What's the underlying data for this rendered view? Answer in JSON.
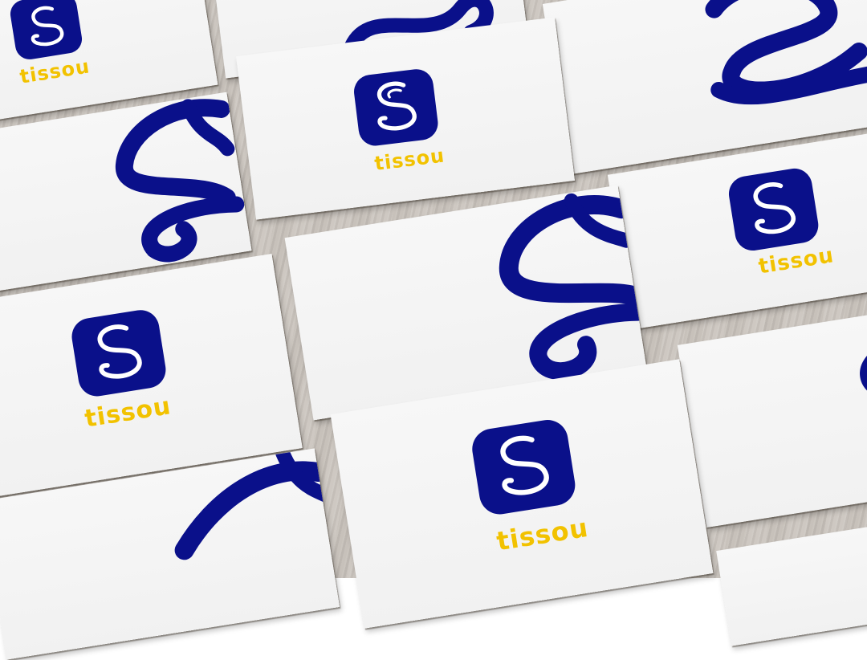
{
  "brand": {
    "name": "tissou",
    "blue": "#0a108a",
    "yellow": "#f2c200",
    "icon": "squiggle-s-icon"
  },
  "colors": {
    "card": "#f4f4f4",
    "wood": "#c9c3bc"
  }
}
